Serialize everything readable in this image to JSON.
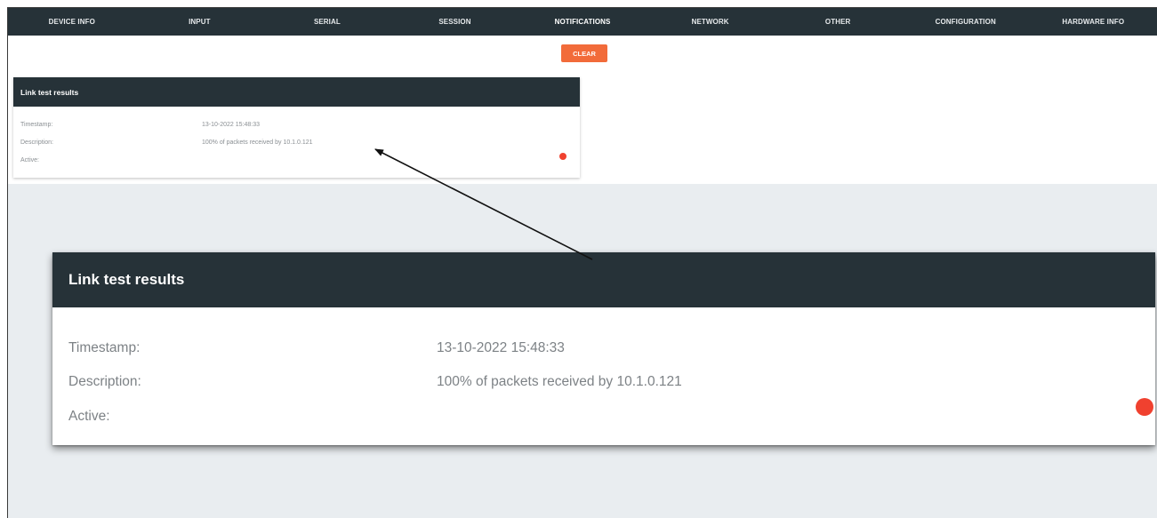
{
  "nav": {
    "tabs": [
      {
        "label": "DEVICE INFO"
      },
      {
        "label": "INPUT"
      },
      {
        "label": "SERIAL"
      },
      {
        "label": "SESSION"
      },
      {
        "label": "NOTIFICATIONS",
        "active": true
      },
      {
        "label": "NETWORK"
      },
      {
        "label": "OTHER"
      },
      {
        "label": "CONFIGURATION"
      },
      {
        "label": "HARDWARE INFO"
      }
    ]
  },
  "toolbar": {
    "clear_label": "CLEAR"
  },
  "notification": {
    "title": "Link test results",
    "fields": [
      {
        "label": "Timestamp:",
        "value": "13-10-2022 15:48:33"
      },
      {
        "label": "Description:",
        "value": "100% of packets received by 10.1.0.121"
      },
      {
        "label": "Active:",
        "value": ""
      }
    ],
    "active_indicator": "red-dot-icon"
  },
  "colors": {
    "nav_bg": "#263238",
    "accent": "#f26b3a",
    "active_dot": "#f0412f",
    "background_grey": "#e9edf0"
  }
}
